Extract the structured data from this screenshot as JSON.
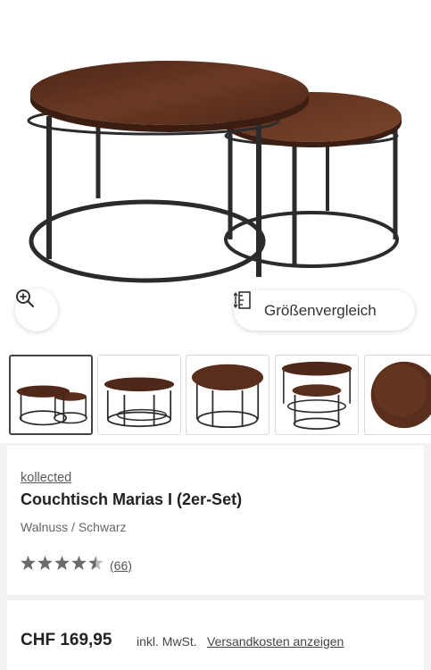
{
  "product": {
    "brand": "kollected",
    "title": "Couchtisch Marias I (2er-Set)",
    "variant": "Walnuss / Schwarz",
    "rating": 4.5,
    "review_count": "(66)"
  },
  "gallery": {
    "zoom_icon": "zoom-in-icon",
    "size_compare_label": "Größenvergleich",
    "size_compare_icon": "measure-icon",
    "thumbnail_count": 5,
    "active_thumbnail": 0
  },
  "pricing": {
    "price": "CHF 169,95",
    "vat_label": "inkl. MwSt.",
    "shipping_link": "Versandkosten anzeigen"
  },
  "colors": {
    "wood": "#5a2e1c",
    "metal": "#2b2b2b",
    "star": "#6b6b6b"
  }
}
